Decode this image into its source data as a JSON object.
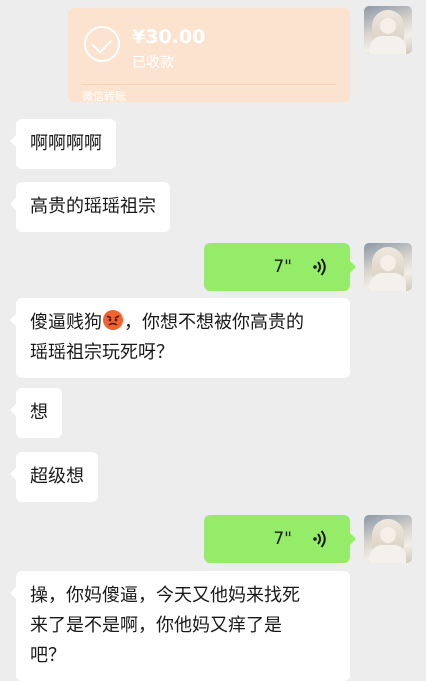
{
  "transfer": {
    "amount": "¥30.00",
    "status": "已收款",
    "source": "微信转账",
    "icon": "check-circle-icon",
    "color": "#fce3cf"
  },
  "messages": [
    {
      "side": "left",
      "text": "啊啊啊啊"
    },
    {
      "side": "left",
      "text": "高贵的瑶瑶祖宗"
    },
    {
      "side": "right",
      "type": "voice",
      "duration": "7\""
    },
    {
      "side": "left",
      "line1_prefix": "傻逼贱狗",
      "emoji": "angry-face-emoji",
      "line1_suffix": "，你想不想被你高贵的",
      "line2": "瑶瑶祖宗玩死呀？"
    },
    {
      "side": "left",
      "text": "想"
    },
    {
      "side": "left",
      "text": "超级想"
    },
    {
      "side": "right",
      "type": "voice",
      "duration": "7\""
    },
    {
      "side": "left",
      "line1": "操，你妈傻逼，今天又他妈来找死",
      "line2": "来了是不是啊，你他妈又痒了是",
      "line3": "吧？"
    }
  ],
  "colors": {
    "background": "#ededed",
    "incoming": "#ffffff",
    "outgoing": "#95ec69"
  }
}
